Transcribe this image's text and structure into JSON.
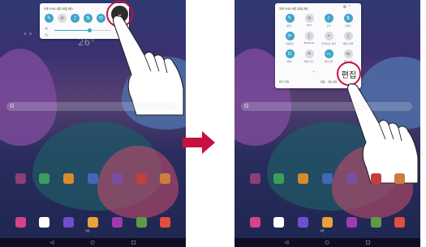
{
  "left_screen": {
    "status_line": "오후 5:00 4월 20일 (화)",
    "home_temp": "26°",
    "quick_panel": {
      "status": "오후 5:00 4월 20일 (화)",
      "toggles": [
        {
          "icon": "edit-icon",
          "glyph": "✎",
          "state": "on"
        },
        {
          "icon": "wifi-icon",
          "glyph": "≋",
          "state": "off"
        },
        {
          "icon": "sound-icon",
          "glyph": "♪",
          "state": "on"
        },
        {
          "icon": "sync-icon",
          "glyph": "⇅",
          "state": "on"
        },
        {
          "icon": "rotate-icon",
          "glyph": "⟳",
          "state": "on"
        }
      ],
      "brightness": {
        "label": "자동",
        "level": 0.62
      },
      "expand_glyph": "⌄"
    },
    "bottom_label": "사진"
  },
  "right_screen": {
    "status_line": "오후 5:00 4월 20일 (화)",
    "quick_panel": {
      "status": "오후 5:00 4월 20일 (화)",
      "tiles": [
        {
          "icon": "edit-icon",
          "glyph": "✎",
          "label": "펜모드",
          "state": "on"
        },
        {
          "icon": "wifi-icon",
          "glyph": "≋",
          "label": "Wi-Fi",
          "state": "off"
        },
        {
          "icon": "sound-icon",
          "glyph": "♪",
          "label": "소리",
          "state": "on"
        },
        {
          "icon": "sync-icon",
          "glyph": "⇅",
          "label": "데이터",
          "state": "on"
        },
        {
          "icon": "rotate-icon",
          "glyph": "⟳",
          "label": "자동회전",
          "state": "on"
        },
        {
          "icon": "bluetooth-icon",
          "glyph": "ᛒ",
          "label": "Bluetooth",
          "state": "off"
        },
        {
          "icon": "location-icon",
          "glyph": "⌖",
          "label": "블루라이트 필터",
          "state": "off"
        },
        {
          "icon": "battery-icon",
          "glyph": "▯",
          "label": "배터리 절약",
          "state": "off"
        },
        {
          "icon": "capture-icon",
          "glyph": "⊡",
          "label": "캡처+",
          "state": "on"
        },
        {
          "icon": "airplane-icon",
          "glyph": "✈",
          "label": "비행기 모드",
          "state": "off"
        },
        {
          "icon": "screen-icon",
          "glyph": "▭",
          "label": "화면 공유",
          "state": "on"
        },
        {
          "icon": "share-icon",
          "glyph": "⇆",
          "label": "파일 공유",
          "state": "off"
        }
      ],
      "footer_left": "밝기 조절",
      "footer_right": "알림 · 사용 설정",
      "edit_label": "편집"
    },
    "bottom_label": "사진"
  },
  "apps_row_1_colors": [
    "#8e3d7a",
    "#3e9d5a",
    "#d98a2a",
    "#4068b8",
    "#7a4ea0",
    "#c63e3e",
    "#cf7d3e"
  ],
  "apps_row_2_colors": [
    "#d8428a",
    "#ffffff",
    "#6e4fcf",
    "#e9a13b",
    "#a03ab0",
    "#5f9b46",
    "#e24e3a"
  ],
  "accent": "#c8103e"
}
